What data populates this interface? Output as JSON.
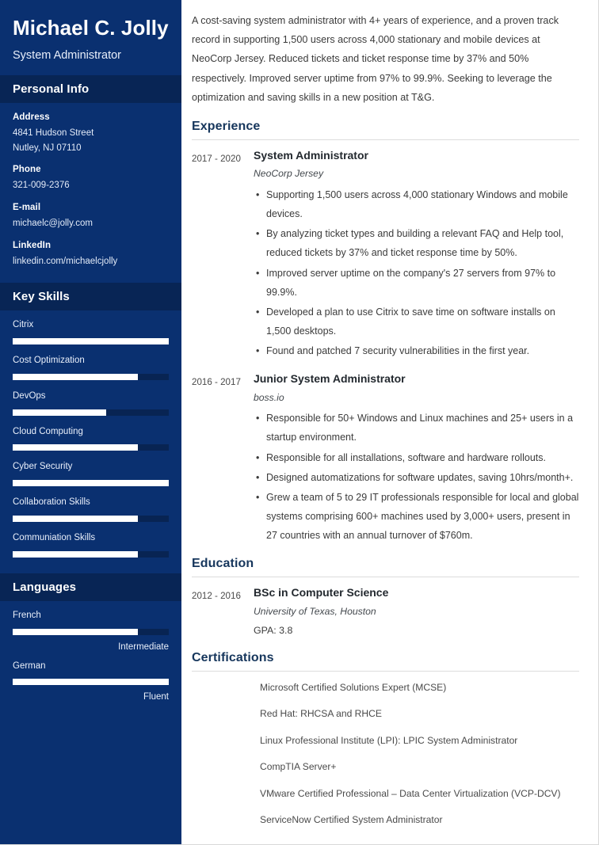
{
  "sidebar": {
    "name": "Michael C. Jolly",
    "job_title": "System Administrator",
    "personal_info": {
      "heading": "Personal Info",
      "fields": [
        {
          "label": "Address",
          "value": "4841 Hudson Street\nNutley, NJ 07110"
        },
        {
          "label": "Phone",
          "value": "321-009-2376"
        },
        {
          "label": "E-mail",
          "value": "michaelc@jolly.com"
        },
        {
          "label": "LinkedIn",
          "value": "linkedin.com/michaelcjolly"
        }
      ]
    },
    "key_skills": {
      "heading": "Key Skills",
      "items": [
        {
          "label": "Citrix",
          "level": 100
        },
        {
          "label": "Cost Optimization",
          "level": 80
        },
        {
          "label": "DevOps",
          "level": 60
        },
        {
          "label": "Cloud Computing",
          "level": 80
        },
        {
          "label": "Cyber Security",
          "level": 100
        },
        {
          "label": "Collaboration Skills",
          "level": 80
        },
        {
          "label": "Communiation Skills",
          "level": 80
        }
      ]
    },
    "languages": {
      "heading": "Languages",
      "items": [
        {
          "label": "French",
          "level": 80,
          "proficiency": "Intermediate"
        },
        {
          "label": "German",
          "level": 100,
          "proficiency": "Fluent"
        }
      ]
    }
  },
  "main": {
    "summary": "A cost-saving system administrator with 4+ years of experience, and a proven track record in supporting 1,500 users across 4,000 stationary and mobile devices at NeoCorp Jersey. Reduced tickets and ticket response time by 37% and 50% respectively. Improved server uptime from 97% to 99.9%. Seeking to leverage the optimization and saving skills in a new position at T&G.",
    "experience": {
      "heading": "Experience",
      "entries": [
        {
          "dates": "2017 - 2020",
          "title": "System Administrator",
          "org": "NeoCorp Jersey",
          "bullets": [
            "Supporting 1,500 users across 4,000 stationary Windows and mobile devices.",
            "By analyzing ticket types and building a relevant FAQ and Help tool, reduced tickets by 37% and ticket response time by 50%.",
            "Improved server uptime on the company's 27 servers from 97% to 99.9%.",
            "Developed a plan to use Citrix to save time on software installs on 1,500 desktops.",
            "Found and patched 7 security vulnerabilities in the first year."
          ]
        },
        {
          "dates": "2016 - 2017",
          "title": "Junior System Administrator",
          "org": "boss.io",
          "bullets": [
            "Responsible for 50+ Windows and Linux machines and 25+ users in a startup environment.",
            "Responsible for all installations, software and hardware rollouts.",
            "Designed automatizations for software updates, saving 10hrs/month+.",
            "Grew a team of 5 to 29 IT professionals responsible for local and global systems comprising 600+ machines used by 3,000+ users, present in 27 countries with an annual turnover of $760m."
          ]
        }
      ]
    },
    "education": {
      "heading": "Education",
      "entries": [
        {
          "dates": "2012 - 2016",
          "title": "BSc in Computer Science",
          "org": "University of Texas, Houston",
          "extra": "GPA: 3.8"
        }
      ]
    },
    "certifications": {
      "heading": "Certifications",
      "items": [
        "Microsoft Certified Solutions Expert (MCSE)",
        "Red Hat: RHCSA and RHCE",
        "Linux Professional Institute (LPI): LPIC System Administrator",
        "CompTIA Server+",
        "VMware Certified Professional – Data Center Virtualization (VCP-DCV)",
        "ServiceNow Certified System Administrator"
      ]
    }
  },
  "colors": {
    "sidebar_bg": "#0a3070",
    "sidebar_head_bg": "#082555",
    "bar_track": "#082453",
    "bar_fill": "#ffffff",
    "heading": "#16365c",
    "rule": "#dcdcdc"
  }
}
